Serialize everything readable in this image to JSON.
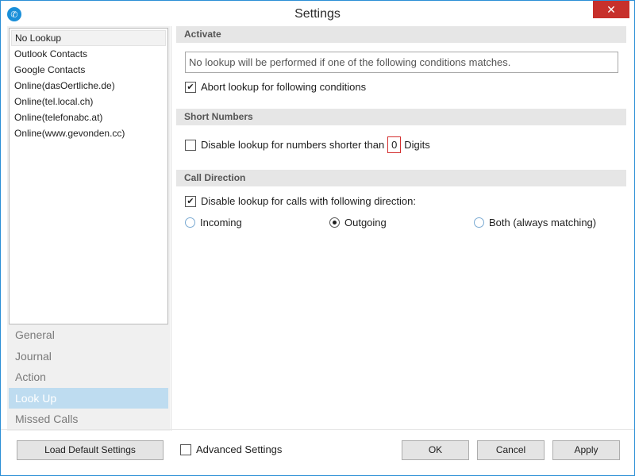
{
  "window": {
    "title": "Settings",
    "close_glyph": "✕",
    "app_icon": "phone-icon"
  },
  "lookup_list": [
    "No Lookup",
    "Outlook Contacts",
    "Google Contacts",
    "Online(dasOertliche.de)",
    "Online(tel.local.ch)",
    "Online(telefonabc.at)",
    "Online(www.gevonden.cc)"
  ],
  "nav": [
    "General",
    "Journal",
    "Action",
    "Look Up",
    "Missed Calls"
  ],
  "activate": {
    "header": "Activate",
    "info_text": "No lookup will be performed if one of the following conditions matches.",
    "abort_label": "Abort lookup for following conditions",
    "abort_checked": true
  },
  "short_numbers": {
    "header": "Short Numbers",
    "disable_label": "Disable lookup for numbers shorter than",
    "digits_value": "0",
    "digits_suffix": "Digits",
    "disable_checked": false
  },
  "call_direction": {
    "header": "Call Direction",
    "disable_label": "Disable lookup for calls with following direction:",
    "disable_checked": true,
    "options": [
      "Incoming",
      "Outgoing",
      "Both (always matching)"
    ],
    "selected": "Outgoing"
  },
  "footer": {
    "load_default": "Load Default Settings",
    "advanced_label": "Advanced Settings",
    "ok": "OK",
    "cancel": "Cancel",
    "apply": "Apply"
  },
  "colors": {
    "accent": "#2b8fd6",
    "close": "#c7302b",
    "nav_active": "#bedcf0",
    "highlight_box": "#d32f2f"
  }
}
